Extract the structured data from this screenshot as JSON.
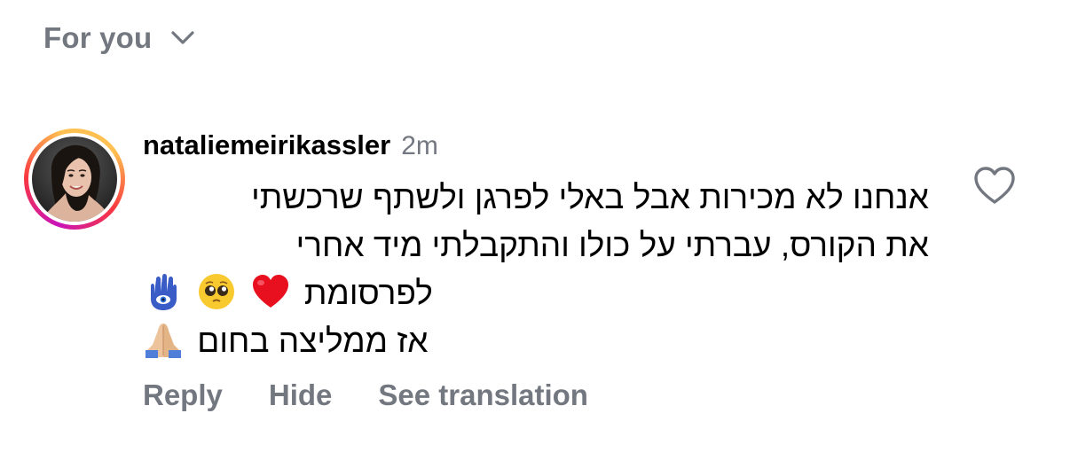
{
  "filter": {
    "label": "For you",
    "chevron_icon": "chevron-down-icon"
  },
  "comment": {
    "username": "nataliemeirikassler",
    "timestamp": "2m",
    "avatar_icon": "profile-photo",
    "lines": [
      "אנחנו לא מכירות אבל באלי לפרגן ולשתף שרכשתי",
      "את הקורס, עברתי על כולו והתקבלתי מיד אחרי",
      "לפרסומת",
      "אז ממליצה בחום"
    ],
    "line3_emojis": [
      "red-heart-emoji",
      "pleading-face-emoji",
      "hamsa-emoji"
    ],
    "line4_emojis": [
      "folded-hands-emoji"
    ],
    "like_icon": "heart-outline-icon"
  },
  "actions": {
    "reply": "Reply",
    "hide": "Hide",
    "see_translation": "See translation"
  },
  "colors": {
    "secondary_text": "#73777f",
    "primary_text": "#000000",
    "story_ring_start": "#c913b9",
    "story_ring_end": "#fec051"
  }
}
